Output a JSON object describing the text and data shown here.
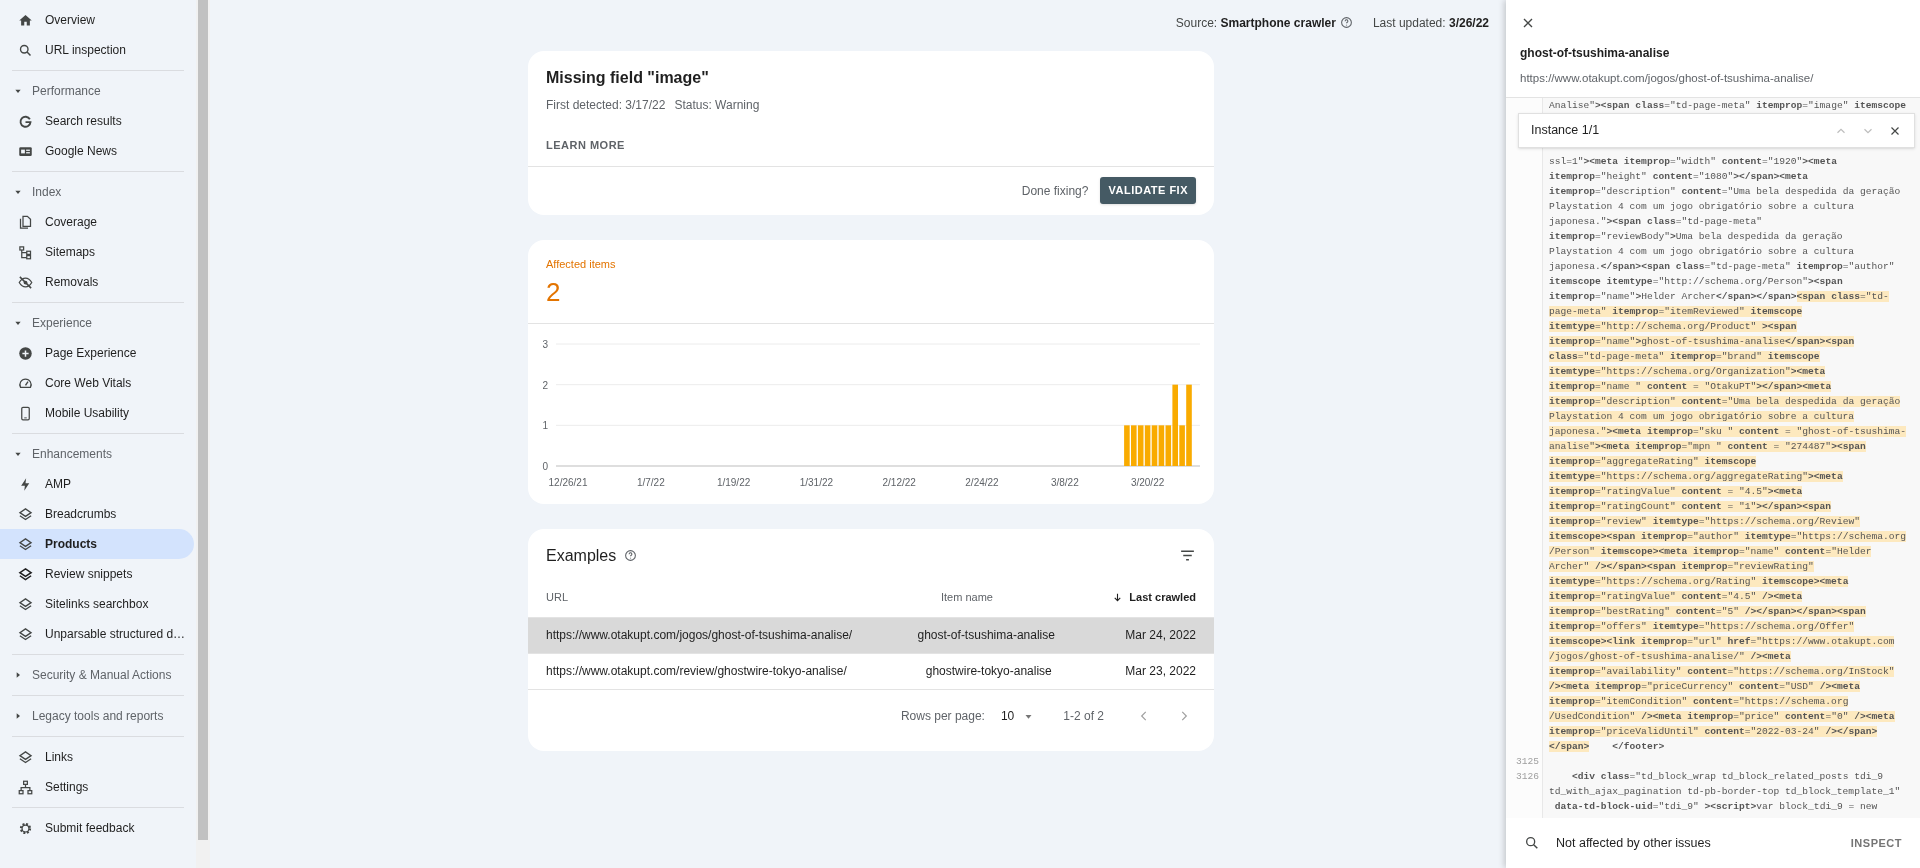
{
  "header": {
    "source_label": "Source:",
    "source_value": "Smartphone crawler",
    "updated_label": "Last updated:",
    "updated_value": "3/26/22"
  },
  "sidebar": {
    "groups": [
      {
        "items": [
          {
            "kind": "link",
            "label": "Overview",
            "selected": false
          },
          {
            "kind": "link",
            "label": "URL inspection",
            "selected": false
          }
        ]
      },
      {
        "items": [
          {
            "kind": "section",
            "label": "Performance",
            "expanded": true,
            "children": [
              {
                "label": "Search results",
                "selected": false
              },
              {
                "label": "Google News",
                "selected": false
              }
            ]
          }
        ]
      },
      {
        "items": [
          {
            "kind": "section",
            "label": "Index",
            "expanded": true,
            "children": [
              {
                "label": "Coverage",
                "selected": false
              },
              {
                "label": "Sitemaps",
                "selected": false
              },
              {
                "label": "Removals",
                "selected": false
              }
            ]
          }
        ]
      },
      {
        "items": [
          {
            "kind": "section",
            "label": "Experience",
            "expanded": true,
            "children": [
              {
                "label": "Page Experience",
                "selected": false
              },
              {
                "label": "Core Web Vitals",
                "selected": false
              },
              {
                "label": "Mobile Usability",
                "selected": false
              }
            ]
          }
        ]
      },
      {
        "items": [
          {
            "kind": "section",
            "label": "Enhancements",
            "expanded": true,
            "children": [
              {
                "label": "AMP",
                "selected": false
              },
              {
                "label": "Breadcrumbs",
                "selected": false
              },
              {
                "label": "Products",
                "selected": true
              },
              {
                "label": "Review snippets",
                "selected": false
              },
              {
                "label": "Sitelinks searchbox",
                "selected": false
              },
              {
                "label": "Unparsable structured d…",
                "selected": false
              }
            ]
          }
        ]
      },
      {
        "items": [
          {
            "kind": "section",
            "label": "Security & Manual Actions",
            "expanded": false
          }
        ]
      },
      {
        "items": [
          {
            "kind": "section",
            "label": "Legacy tools and reports",
            "expanded": false
          }
        ]
      },
      {
        "items": [
          {
            "kind": "link",
            "label": "Links",
            "selected": false
          },
          {
            "kind": "link",
            "label": "Settings",
            "selected": false
          }
        ]
      },
      {
        "items": [
          {
            "kind": "link",
            "label": "Submit feedback",
            "selected": false
          }
        ]
      }
    ]
  },
  "issue_card": {
    "title": "Missing field \"image\"",
    "first_detected": "First detected: 3/17/22",
    "status": "Status: Warning",
    "learn_more": "LEARN MORE",
    "done_prompt": "Done fixing?",
    "validate_button": "VALIDATE FIX"
  },
  "affected": {
    "label": "Affected items",
    "count": "2",
    "chart_data": {
      "type": "bar",
      "categories": [
        "12/26/21",
        null,
        null,
        null,
        null,
        null,
        null,
        null,
        null,
        null,
        null,
        null,
        "1/7/22",
        null,
        null,
        null,
        null,
        null,
        null,
        null,
        null,
        null,
        null,
        null,
        "1/19/22",
        null,
        null,
        null,
        null,
        null,
        null,
        null,
        null,
        null,
        null,
        null,
        "1/31/22",
        null,
        null,
        null,
        null,
        null,
        null,
        null,
        null,
        null,
        null,
        null,
        "2/12/22",
        null,
        null,
        null,
        null,
        null,
        null,
        null,
        null,
        null,
        null,
        null,
        "2/24/22",
        null,
        null,
        null,
        null,
        null,
        null,
        null,
        null,
        null,
        null,
        null,
        "3/8/22",
        null,
        null,
        null,
        null,
        null,
        null,
        null,
        null,
        null,
        null,
        null,
        "3/20/22",
        null,
        null,
        null,
        null,
        null,
        null
      ],
      "series": [
        {
          "color": "#f9ab00",
          "values": [
            null,
            null,
            null,
            null,
            null,
            null,
            null,
            null,
            null,
            null,
            null,
            null,
            null,
            null,
            null,
            null,
            null,
            null,
            null,
            null,
            null,
            null,
            null,
            null,
            null,
            null,
            null,
            null,
            null,
            null,
            null,
            null,
            null,
            null,
            null,
            null,
            null,
            null,
            null,
            null,
            null,
            null,
            null,
            null,
            null,
            null,
            null,
            null,
            null,
            null,
            null,
            null,
            null,
            null,
            null,
            null,
            null,
            null,
            null,
            null,
            null,
            null,
            null,
            null,
            null,
            null,
            null,
            null,
            null,
            null,
            null,
            null,
            null,
            null,
            null,
            null,
            null,
            null,
            null,
            null,
            null,
            1,
            1,
            1,
            1,
            1,
            1,
            1,
            2,
            1,
            2
          ]
        }
      ],
      "ylim": [
        0,
        3
      ],
      "yticks": [
        0,
        1,
        2,
        3
      ]
    }
  },
  "examples": {
    "title": "Examples",
    "columns": [
      {
        "label": "URL",
        "sorted": false
      },
      {
        "label": "Item name",
        "sorted": false
      },
      {
        "label": "Last crawled",
        "sorted": true
      }
    ],
    "rows": [
      {
        "selected": true,
        "cells": [
          "https://www.otakupt.com/jogos/ghost-of-tsushima-analise/",
          "ghost-of-tsushima-analise",
          "Mar 24, 2022"
        ]
      },
      {
        "selected": false,
        "cells": [
          "https://www.otakupt.com/review/ghostwire-tokyo-analise/",
          "ghostwire-tokyo-analise",
          "Mar 23, 2022"
        ]
      }
    ],
    "rows_per_page_label": "Rows per page:",
    "rows_per_page": "10",
    "range": "1-2 of 2"
  },
  "detail": {
    "title": "ghost-of-tsushima-analise",
    "url": "https://www.otakupt.com/jogos/ghost-of-tsushima-analise/",
    "instance": "Instance 1/1",
    "code_lines": [
      {
        "segments": [
          {
            "text": "Analise\"**><span class**=\"td-page-meta\" **itemprop**=\"image\" **itemscope**",
            "highlighted": false
          }
        ]
      },
      {
        "segments": [
          {
            "text": "ssl=1\"**><meta itemprop**=\"width\" **content**=\"1920\"**><meta**",
            "highlighted": false
          }
        ]
      },
      {
        "segments": [
          {
            "text": "**itemprop**=\"height\" **content**=\"1080\"**></span><meta**",
            "highlighted": false
          }
        ]
      },
      {
        "segments": [
          {
            "text": "**itemprop**=\"description\" **content**=\"Uma bela despedida da geração",
            "highlighted": false
          }
        ]
      },
      {
        "segments": [
          {
            "text": "Playstation 4 com um jogo obrigatório sobre a cultura",
            "highlighted": false
          }
        ]
      },
      {
        "segments": [
          {
            "text": "japonesa.\"**><span class**=\"td-page-meta\"",
            "highlighted": false
          }
        ]
      },
      {
        "segments": [
          {
            "text": "**itemprop**=\"reviewBody\"**>**Uma bela despedida da geração",
            "highlighted": false
          }
        ]
      },
      {
        "segments": [
          {
            "text": "Playstation 4 com um jogo obrigatório sobre a cultura",
            "highlighted": false
          }
        ]
      },
      {
        "segments": [
          {
            "text": "japonesa.**</span><span class**=\"td-page-meta\" **itemprop**=\"author\"",
            "highlighted": false
          }
        ]
      },
      {
        "segments": [
          {
            "text": "**itemscope itemtype**=\"http://schema.org/Person\"**><span**",
            "highlighted": false
          }
        ]
      },
      {
        "segments": [
          {
            "text": "**itemprop**=\"name\"**>**Helder Archer**</span></span>**",
            "highlighted": false
          },
          {
            "text": "**<span class**=\"td-",
            "highlighted": true
          }
        ]
      },
      {
        "segments": [
          {
            "text": "page-meta\" **itemprop**=\"itemReviewed\" **itemscope**",
            "highlighted": true
          }
        ]
      },
      {
        "segments": [
          {
            "text": "**itemtype**=\"http://schema.org/Product\" **><span**",
            "highlighted": true
          }
        ]
      },
      {
        "segments": [
          {
            "text": "**itemprop**=\"name\"**>**ghost-of-tsushima-analise**</span><span**",
            "highlighted": true
          }
        ]
      },
      {
        "segments": [
          {
            "text": "**class**=\"td-page-meta\" **itemprop**=\"brand\" **itemscope**",
            "highlighted": true
          }
        ]
      },
      {
        "segments": [
          {
            "text": "**itemtype**=\"https://schema.org/Organization\"**><meta**",
            "highlighted": true
          }
        ]
      },
      {
        "segments": [
          {
            "text": "**itemprop**=\"name \" **content** = \"OtakuPT\"**></span><meta**",
            "highlighted": true
          }
        ]
      },
      {
        "segments": [
          {
            "text": "**itemprop**=\"description\" **content**=\"Uma bela despedida da geração",
            "highlighted": true
          }
        ]
      },
      {
        "segments": [
          {
            "text": "Playstation 4 com um jogo obrigatório sobre a cultura",
            "highlighted": true
          }
        ]
      },
      {
        "segments": [
          {
            "text": "japonesa.\"**><meta itemprop**=\"sku \" **content** = \"ghost-of-tsushima-",
            "highlighted": true
          }
        ]
      },
      {
        "segments": [
          {
            "text": "analise\"**><meta itemprop**=\"mpn \" **content** = \"274487\"**><span**",
            "highlighted": true
          }
        ]
      },
      {
        "segments": [
          {
            "text": "**itemprop**=\"aggregateRating\" **itemscope**",
            "highlighted": true
          }
        ]
      },
      {
        "segments": [
          {
            "text": "**itemtype**=\"https://schema.org/aggregateRating\"**><meta**",
            "highlighted": true
          }
        ]
      },
      {
        "segments": [
          {
            "text": "**itemprop**=\"ratingValue\" **content** = \"4.5\"**><meta**",
            "highlighted": true
          }
        ]
      },
      {
        "segments": [
          {
            "text": "**itemprop**=\"ratingCount\" **content** = \"1\"**></span><span**",
            "highlighted": true
          }
        ]
      },
      {
        "segments": [
          {
            "text": "**itemprop**=\"review\" **itemtype**=\"https://schema.org/Review\"",
            "highlighted": true
          }
        ]
      },
      {
        "segments": [
          {
            "text": "**itemscope><span itemprop**=\"author\" **itemtype**=\"https://schema.org",
            "highlighted": true
          }
        ]
      },
      {
        "segments": [
          {
            "text": "/Person\" **itemscope><meta itemprop**=\"name\" **content**=\"Helder",
            "highlighted": true
          }
        ]
      },
      {
        "segments": [
          {
            "text": "Archer\" **/></span><span itemprop**=\"reviewRating\"",
            "highlighted": true
          }
        ]
      },
      {
        "segments": [
          {
            "text": "**itemtype**=\"https://schema.org/Rating\" **itemscope><meta**",
            "highlighted": true
          }
        ]
      },
      {
        "segments": [
          {
            "text": "**itemprop**=\"ratingValue\" **content**=\"4.5\" **/><meta**",
            "highlighted": true
          }
        ]
      },
      {
        "segments": [
          {
            "text": "**itemprop**=\"bestRating\" **content**=\"5\" **/></span></span><span**",
            "highlighted": true
          }
        ]
      },
      {
        "segments": [
          {
            "text": "**itemprop**=\"offers\" **itemtype**=\"https://schema.org/Offer\"",
            "highlighted": true
          }
        ]
      },
      {
        "segments": [
          {
            "text": "**itemscope><link itemprop**=\"url\" **href**=\"https://www.otakupt.com",
            "highlighted": true
          }
        ]
      },
      {
        "segments": [
          {
            "text": "/jogos/ghost-of-tsushima-analise/\" **/><meta**",
            "highlighted": true
          }
        ]
      },
      {
        "segments": [
          {
            "text": "**itemprop**=\"availability\" **content**=\"https://schema.org/InStock\"",
            "highlighted": true
          }
        ]
      },
      {
        "segments": [
          {
            "text": "**/><meta itemprop**=\"priceCurrency\" **content**=\"USD\" **/><meta**",
            "highlighted": true
          }
        ]
      },
      {
        "segments": [
          {
            "text": "**itemprop**=\"itemCondition\" **content**=\"https://schema.org",
            "highlighted": true
          }
        ]
      },
      {
        "segments": [
          {
            "text": "/UsedCondition\" **/><meta itemprop**=\"price\" **content**=\"0\" **/><meta**",
            "highlighted": true
          }
        ]
      },
      {
        "segments": [
          {
            "text": "**itemprop**=\"priceValidUntil\" **content**=\"2022-03-24\" **/></span>**",
            "highlighted": true
          }
        ]
      },
      {
        "segments": [
          {
            "text": "**</span>**",
            "highlighted": true
          },
          {
            "text": "    **</footer>**",
            "highlighted": false
          }
        ]
      },
      {
        "number": "3125"
      },
      {
        "number": "3126",
        "segments": [
          {
            "text": "    **<div class**=\"td_block_wrap td_block_related_posts tdi_9",
            "highlighted": false
          }
        ]
      },
      {
        "segments": [
          {
            "text": "td_with_ajax_pagination td-pb-border-top td_block_template_1\"",
            "highlighted": false
          }
        ]
      },
      {
        "segments": [
          {
            "text": " **data-td-block-uid**=\"tdi_9\" **><script>**var block_tdi_9 = new",
            "highlighted": false
          }
        ]
      }
    ],
    "footer_text": "Not affected by other issues",
    "inspect": "INSPECT"
  }
}
